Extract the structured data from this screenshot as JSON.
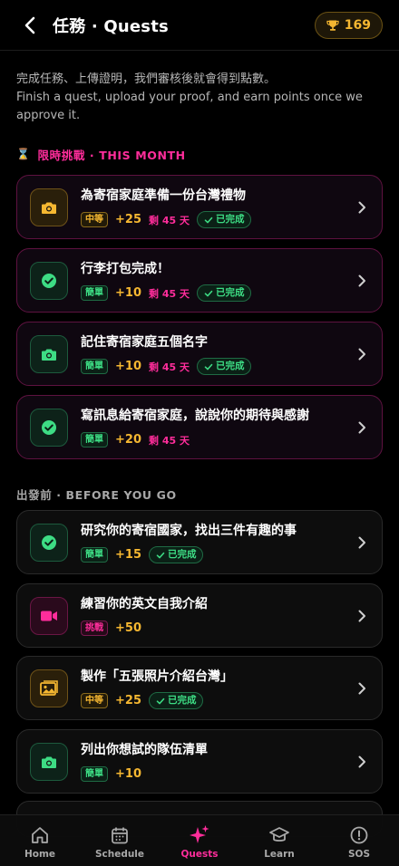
{
  "header": {
    "title": "任務 · Quests",
    "points": "169"
  },
  "intro": {
    "zh": "完成任務、上傳證明，我們審核後就會得到點數。",
    "en": "Finish a quest, upload your proof, and earn points once we approve it."
  },
  "sections": {
    "month": {
      "icon": "⌛",
      "label": "限時挑戰 · THIS MONTH"
    },
    "before": {
      "label": "出發前 · BEFORE YOU GO"
    }
  },
  "month_quests": [
    {
      "title": "為寄宿家庭準備一份台灣禮物",
      "level": "中等",
      "points": "+25",
      "days_left": "剩 45 天",
      "done": "已完成",
      "icon": "camera-icon",
      "tone": "orange"
    },
    {
      "title": "行李打包完成！",
      "level": "簡單",
      "points": "+10",
      "days_left": "剩 45 天",
      "done": "已完成",
      "icon": "check-circle-icon",
      "tone": "green"
    },
    {
      "title": "記住寄宿家庭五個名字",
      "level": "簡單",
      "points": "+10",
      "days_left": "剩 45 天",
      "done": "已完成",
      "icon": "camera-icon",
      "tone": "green"
    },
    {
      "title": "寫訊息給寄宿家庭，說說你的期待與感謝",
      "level": "簡單",
      "points": "+20",
      "days_left": "剩 45 天",
      "done": "",
      "icon": "check-circle-icon",
      "tone": "green"
    }
  ],
  "before_quests": [
    {
      "title": "研究你的寄宿國家，找出三件有趣的事",
      "level": "簡單",
      "points": "+15",
      "done": "已完成",
      "icon": "check-circle-icon",
      "tone": "green"
    },
    {
      "title": "練習你的英文自我介紹",
      "level": "挑戰",
      "points": "+50",
      "done": "",
      "icon": "video-icon",
      "tone": "pink"
    },
    {
      "title": "製作「五張照片介紹台灣」",
      "level": "中等",
      "points": "+25",
      "done": "已完成",
      "icon": "image-icon",
      "tone": "orange"
    },
    {
      "title": "列出你想試的隊伍清單",
      "level": "簡單",
      "points": "+10",
      "done": "",
      "icon": "camera-icon",
      "tone": "green"
    }
  ],
  "tabs": [
    {
      "label": "Home",
      "icon": "home-icon"
    },
    {
      "label": "Schedule",
      "icon": "calendar-icon"
    },
    {
      "label": "Quests",
      "icon": "sparkles-icon",
      "active": true
    },
    {
      "label": "Learn",
      "icon": "graduation-cap-icon"
    },
    {
      "label": "SOS",
      "icon": "alert-circle-icon"
    }
  ],
  "colors": {
    "accent_pink": "#ff2d9b",
    "gold": "#f5b731",
    "green": "#3ddc84"
  }
}
